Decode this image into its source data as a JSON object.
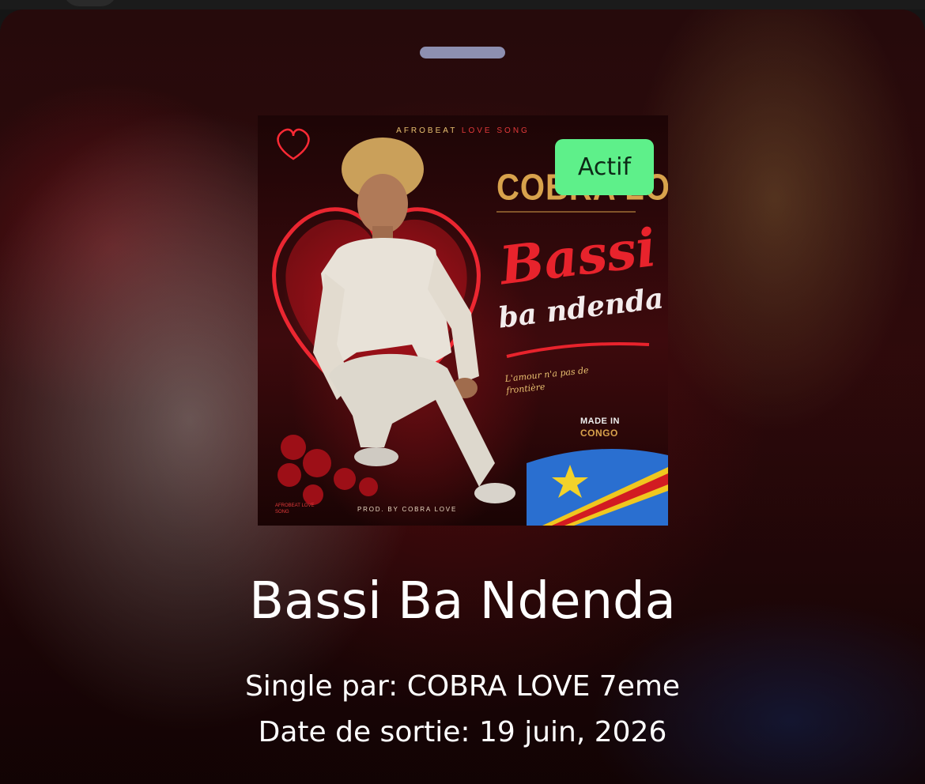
{
  "sheet": {
    "status_badge": "Actif",
    "title": "Bassi Ba Ndenda",
    "artist_line": "Single par: COBRA LOVE 7eme",
    "release_line": "Date de sortie: 19 juin, 2026"
  },
  "cover_art": {
    "tagline_a": "AFROBEAT",
    "tagline_b": "LOVE SONG",
    "artist": "COBRA LOVE",
    "title_line1": "Bassi",
    "title_line2": "ba ndenda",
    "slogan": "L'amour n'a pas de frontière",
    "made_in": "MADE IN",
    "country": "CONGO",
    "producer": "PROD. BY COBRA LOVE",
    "corner_tag": "AFROBEAT LOVE SONG"
  },
  "colors": {
    "badge_green": "#5ef08a",
    "accent_red": "#e8232c",
    "gold": "#d8a24c",
    "grabber": "#8d8fb0"
  }
}
